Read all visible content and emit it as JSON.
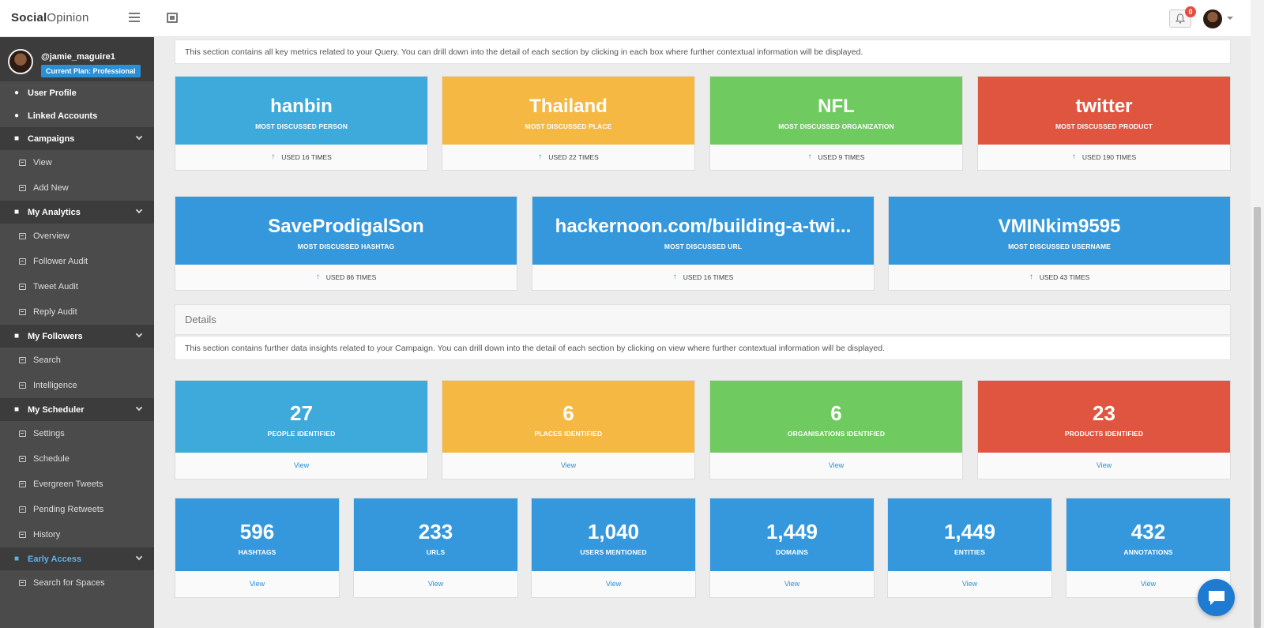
{
  "header": {
    "logo_bold": "Social",
    "logo_rest": "Opinion",
    "notification_count": "0"
  },
  "sidebar": {
    "username": "@jamie_maguire1",
    "plan": "Current Plan: Professional",
    "items": [
      {
        "label": "User Profile",
        "icon": "user-icon"
      },
      {
        "label": "Linked Accounts",
        "icon": "user-icon"
      }
    ],
    "sections": [
      {
        "label": "Campaigns",
        "subs": [
          "View",
          "Add New"
        ]
      },
      {
        "label": "My Analytics",
        "subs": [
          "Overview",
          "Follower Audit",
          "Tweet Audit",
          "Reply Audit"
        ]
      },
      {
        "label": "My Followers",
        "subs": [
          "Search",
          "Intelligence"
        ]
      },
      {
        "label": "My Scheduler",
        "subs": [
          "Settings",
          "Schedule",
          "Evergreen Tweets",
          "Pending Retweets",
          "History"
        ]
      },
      {
        "label": "Early Access",
        "subs": [
          "Search for Spaces"
        ]
      }
    ]
  },
  "main": {
    "intro_text": "This section contains all key metrics related to your Query. You can drill down into the detail of each section by clicking in each box where further contextual information will be displayed.",
    "key_metrics": [
      {
        "value": "hanbin",
        "label": "MOST DISCUSSED PERSON",
        "footer": "USED 16 TIMES",
        "color": "#3eaadb"
      },
      {
        "value": "Thailand",
        "label": "MOST DISCUSSED PLACE",
        "footer": "USED 22 TIMES",
        "color": "#f5b842"
      },
      {
        "value": "NFL",
        "label": "MOST DISCUSSED ORGANIZATION",
        "footer": "USED 9 TIMES",
        "color": "#6fca5f"
      },
      {
        "value": "twitter",
        "label": "MOST DISCUSSED PRODUCT",
        "footer": "USED 190 TIMES",
        "color": "#e05540"
      }
    ],
    "key_metrics_2": [
      {
        "value": "SaveProdigalSon",
        "label": "MOST DISCUSSED HASHTAG",
        "footer": "USED 86 TIMES",
        "color": "#3598dc"
      },
      {
        "value": "hackernoon.com/building-a-twi...",
        "label": "MOST DISCUSSED URL",
        "footer": "USED 16 TIMES",
        "color": "#3598dc"
      },
      {
        "value": "VMINkim9595",
        "label": "MOST DISCUSSED USERNAME",
        "footer": "USED 43 TIMES",
        "color": "#3598dc"
      }
    ],
    "details_title": "Details",
    "details_text": "This section contains further data insights related to your Campaign. You can drill down into the detail of each section by clicking on view where further contextual information will be displayed.",
    "details_1": [
      {
        "value": "27",
        "label": "PEOPLE IDENTIFIED",
        "link": "View",
        "color": "#3eaadb"
      },
      {
        "value": "6",
        "label": "PLACES IDENTIFIED",
        "link": "View",
        "color": "#f5b842"
      },
      {
        "value": "6",
        "label": "ORGANISATIONS IDENTIFIED",
        "link": "View",
        "color": "#6fca5f"
      },
      {
        "value": "23",
        "label": "PRODUCTS IDENTIFIED",
        "link": "View",
        "color": "#e05540"
      }
    ],
    "details_2": [
      {
        "value": "596",
        "label": "HASHTAGS",
        "link": "View",
        "color": "#3598dc"
      },
      {
        "value": "233",
        "label": "URLS",
        "link": "View",
        "color": "#3598dc"
      },
      {
        "value": "1,040",
        "label": "USERS MENTIONED",
        "link": "View",
        "color": "#3598dc"
      },
      {
        "value": "1,449",
        "label": "DOMAINS",
        "link": "View",
        "color": "#3598dc"
      },
      {
        "value": "1,449",
        "label": "ENTITIES",
        "link": "View",
        "color": "#3598dc"
      },
      {
        "value": "432",
        "label": "ANNOTATIONS",
        "link": "View",
        "color": "#3598dc"
      }
    ]
  }
}
